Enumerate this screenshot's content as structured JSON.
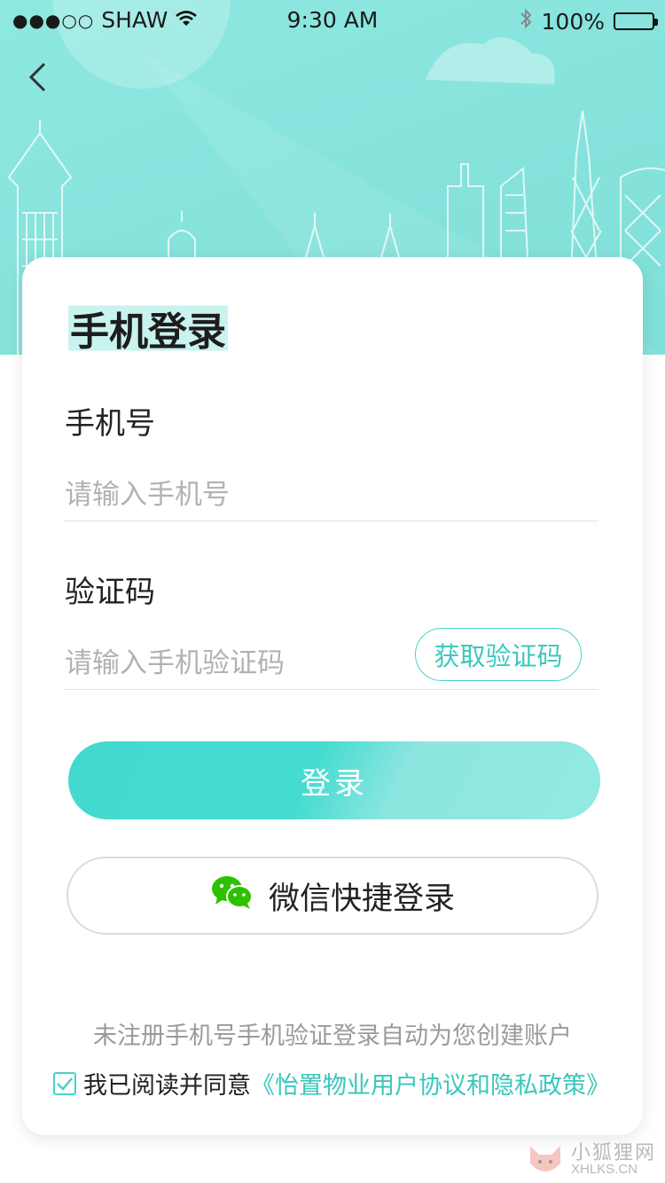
{
  "status_bar": {
    "signal": "●●●○○",
    "carrier": "SHAW",
    "time": "9:30 AM",
    "battery": "100%",
    "icons": [
      "wifi-icon",
      "bluetooth-icon",
      "battery-icon"
    ]
  },
  "nav": {
    "back_icon": "chevron-left-icon"
  },
  "card": {
    "title": "手机登录",
    "phone_label": "手机号",
    "phone_placeholder": "请输入手机号",
    "code_label": "验证码",
    "code_placeholder": "请输入手机验证码",
    "get_code": "获取验证码",
    "login": "登录",
    "wechat_login": "微信快捷登录",
    "wechat_icon": "wechat-icon",
    "notice": "未注册手机号手机验证登录自动为您创建账户",
    "agree_text": "我已阅读并同意",
    "agreement_link": "《怡置物业用户协议和隐私政策》",
    "agreement_checked": true
  },
  "watermark": {
    "cn": "小狐狸网",
    "en": "XHLKS.CN"
  },
  "colors": {
    "accent": "#45d4c8",
    "hero": "#8ee8e1",
    "wechat_green": "#2dc100"
  }
}
